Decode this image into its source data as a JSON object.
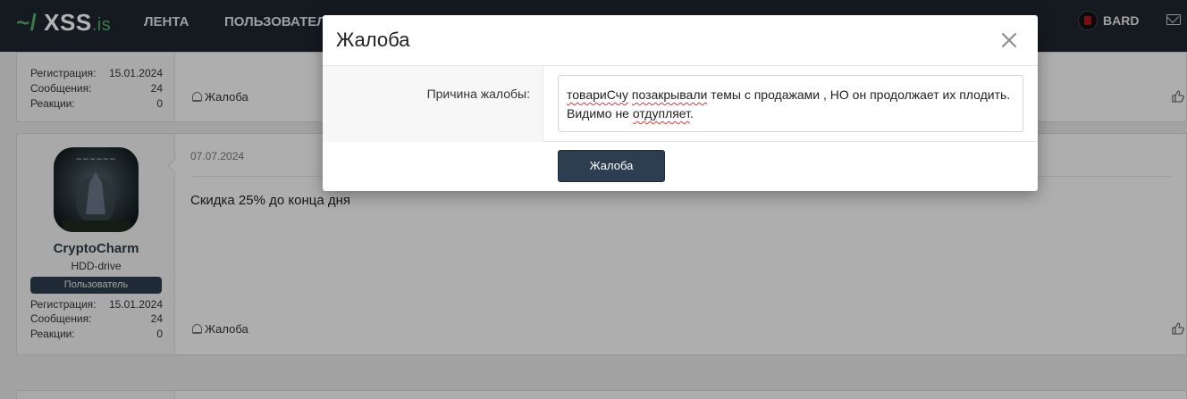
{
  "nav": {
    "logo_tilde": "~/",
    "logo_name": "XSS",
    "logo_tld": ".is",
    "links": [
      "ЛЕНТА",
      "ПОЛЬЗОВАТЕЛ"
    ],
    "username": "BARD"
  },
  "posts": [
    {
      "stats": [
        {
          "label": "Регистрация:",
          "value": "15.01.2024"
        },
        {
          "label": "Сообщения:",
          "value": "24"
        },
        {
          "label": "Реакции:",
          "value": "0"
        }
      ],
      "report_label": "Жалоба"
    },
    {
      "date": "07.07.2024",
      "text": "Скидка 25% до конца дня",
      "username": "CryptoCharm",
      "user_title": "HDD-drive",
      "role": "Пользователь",
      "stats": [
        {
          "label": "Регистрация:",
          "value": "15.01.2024"
        },
        {
          "label": "Сообщения:",
          "value": "24"
        },
        {
          "label": "Реакции:",
          "value": "0"
        }
      ],
      "report_label": "Жалоба"
    }
  ],
  "modal": {
    "title": "Жалоба",
    "field_label": "Причина жалобы:",
    "reason_parts": [
      "товариСчу",
      " ",
      "позакрывали",
      " темы с продажами , НО он продолжает их плодить. Видимо не ",
      "отдупляет",
      "."
    ],
    "submit_label": "Жалоба"
  }
}
